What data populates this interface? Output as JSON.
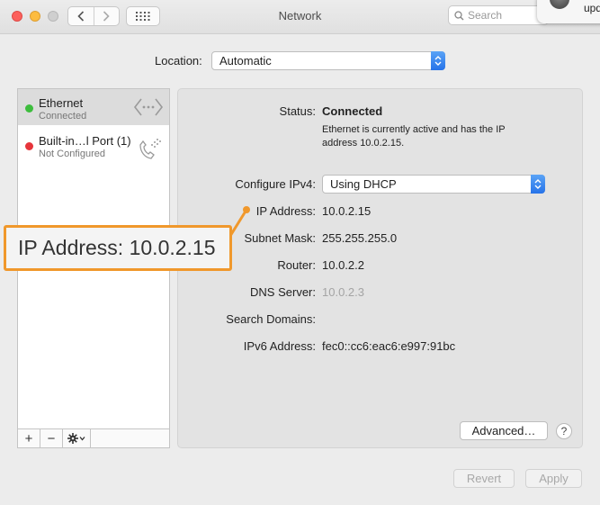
{
  "window": {
    "title": "Network"
  },
  "toolbar": {
    "search_placeholder": "Search"
  },
  "notification": {
    "text": "upd"
  },
  "location": {
    "label": "Location:",
    "value": "Automatic"
  },
  "services": [
    {
      "name": "Ethernet",
      "status": "Connected",
      "dot_color": "#3dbd3d",
      "icon": "ethernet-arrows-icon"
    },
    {
      "name": "Built-in…l Port (1)",
      "status": "Not Configured",
      "dot_color": "#e6353b",
      "icon": "modem-phone-icon"
    }
  ],
  "sidebar_tools": {
    "add": "+",
    "remove": "−"
  },
  "details": {
    "status_label": "Status:",
    "status_value": "Connected",
    "status_description": "Ethernet is currently active and has the IP address 10.0.2.15.",
    "configure_label": "Configure IPv4:",
    "configure_value": "Using DHCP",
    "ip_label": "IP Address:",
    "ip_value": "10.0.2.15",
    "subnet_label": "Subnet Mask:",
    "subnet_value": "255.255.255.0",
    "router_label": "Router:",
    "router_value": "10.0.2.2",
    "dns_label": "DNS Server:",
    "dns_value": "10.0.2.3",
    "search_domains_label": "Search Domains:",
    "ipv6_label": "IPv6 Address:",
    "ipv6_value": "fec0::cc6:eac6:e997:91bc"
  },
  "buttons": {
    "advanced": "Advanced…",
    "help": "?",
    "revert": "Revert",
    "apply": "Apply"
  },
  "callout": {
    "text": "IP Address:  10.0.2.15",
    "color": "#f0982c"
  }
}
